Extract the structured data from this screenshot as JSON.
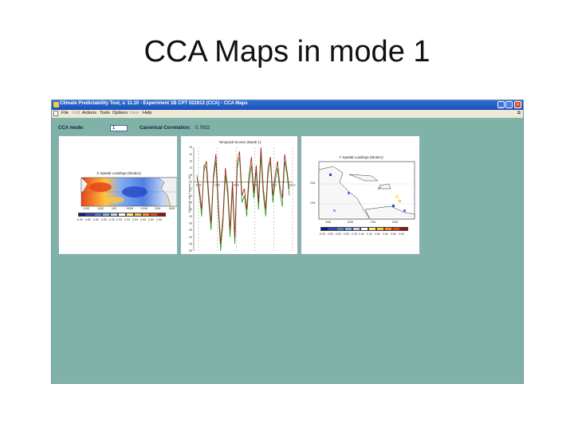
{
  "slide": {
    "title": "CCA Maps in mode 1"
  },
  "window": {
    "title": "Climate Predictability Tool, v. 11.10 - Experiment 1B CPT 022812 (CCA) - CCA Maps",
    "buttons": {
      "minimize": "_",
      "maximize": "□",
      "close": "×"
    }
  },
  "menu": {
    "items": [
      {
        "label": "File",
        "enabled": true
      },
      {
        "label": "Edit",
        "enabled": false
      },
      {
        "label": "Actions",
        "enabled": true
      },
      {
        "label": "Tools",
        "enabled": true
      },
      {
        "label": "Options",
        "enabled": true
      },
      {
        "label": "View",
        "enabled": false
      },
      {
        "label": "Help",
        "enabled": true
      }
    ]
  },
  "controls": {
    "cca_mode_label": "CCA mode:",
    "cca_mode_value": "1",
    "canonical_label": "Canonical Correlation:",
    "canonical_value": "0.7632"
  },
  "panels": {
    "x_map": {
      "title": "X Spatial Loadings (Mode1)",
      "lon_ticks": [
        "120E",
        "150E",
        "180",
        "150W",
        "120W",
        "90W",
        "60W"
      ],
      "colorbar_ticks": [
        "-0.90",
        "-0.80",
        "-0.60",
        "-0.50",
        "-0.30",
        "0.00",
        "0.30",
        "0.50",
        "0.60",
        "0.80",
        "0.90"
      ]
    },
    "temporal": {
      "title": "Temporal Scores (Mode 1)",
      "ylabel": "Scores (X red, Y green) (x 100)",
      "y_ticks": [
        "25",
        "20",
        "15",
        "10",
        "5",
        "0",
        "-5",
        "-10",
        "-15",
        "-20",
        "-25",
        "-30",
        "-35",
        "-40",
        "-45",
        "-50"
      ],
      "x_ticks": [
        "1960",
        "1970",
        "1980",
        "1990",
        "2000",
        "2010"
      ]
    },
    "y_map": {
      "title": "Y Spatial Loadings (Mode1)",
      "lat_ticks": [
        "20N",
        "10N"
      ],
      "lon_ticks": [
        "90W",
        "80W",
        "70W",
        "60W"
      ],
      "colorbar_ticks": [
        "-0.90",
        "-0.80",
        "-0.60",
        "-0.50",
        "-0.30",
        "0.00",
        "0.30",
        "0.50",
        "0.60",
        "0.80",
        "0.90"
      ]
    }
  },
  "colors": {
    "window_bg": "#80b3a8",
    "titlebar": "#2259c8",
    "x_series": "#a01818",
    "y_series": "#1e9a1e",
    "colorbar": [
      "#0a1a8c",
      "#2747c9",
      "#4f7fe0",
      "#86aef0",
      "#bcd3f6",
      "#ffffff",
      "#ffe88a",
      "#ffc340",
      "#ff8a1a",
      "#e8431a",
      "#a00d0d"
    ]
  }
}
